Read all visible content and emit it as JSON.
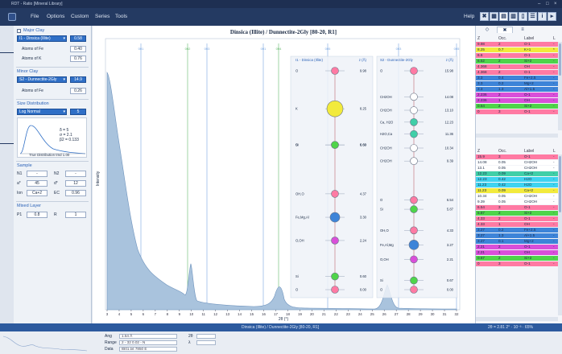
{
  "window": {
    "title": "RDT - Ratio [Mineral Library]"
  },
  "menu": {
    "items": [
      "File",
      "Options",
      "Custom",
      "Series",
      "Tools"
    ],
    "help": "Help"
  },
  "major_clay": {
    "title": "Major Clay",
    "selected": "I1 - Dinsica (Illite)",
    "value": "0.58",
    "fe_label": "Atoms of Fe",
    "fe_value": "0.40",
    "k_label": "Atoms of K",
    "k_value": "0.76"
  },
  "minor_clay": {
    "title": "Minor Clay",
    "selected": "S2 - Dunnectite-2Gly",
    "value": "14.9",
    "fe_label": "Atoms of Fe",
    "fe_value": "0.26"
  },
  "size_distribution": {
    "title": "Size Distribution",
    "selected": "Log Normal",
    "value": "5",
    "stats": [
      "δ = 5",
      "σ = 2.1",
      "β2 = 0.133"
    ],
    "caption": "True Distribution   tmd 1.00"
  },
  "sample": {
    "title": "Sample",
    "n1_label": "N1",
    "n1_value": "-",
    "n2_label": "N2",
    "n2_value": "-",
    "a_label": "a*",
    "a_value": "45",
    "d_label": "d*",
    "d_value": "12",
    "ion_label": "Ion",
    "ion_value": "Ca+2",
    "ec_label": "EC",
    "ec_value": "0.96"
  },
  "mixed_layer": {
    "title": "Mixed Layer",
    "p1_label": "P1",
    "p1_value": "0.8",
    "r_label": "R",
    "r_value": "1"
  },
  "plot": {
    "title": "Dinsica (Illite) / Dunnectite-2Gly  [80-20, R1]",
    "ylabel": "Intensity",
    "xlabel": "2θ (°)",
    "x_ticks": [
      "3",
      "4",
      "5",
      "6",
      "7",
      "8",
      "9",
      "10",
      "11",
      "12",
      "13",
      "14",
      "15",
      "16",
      "17",
      "18",
      "19",
      "20",
      "21",
      "22",
      "23",
      "24",
      "25",
      "26",
      "27",
      "28",
      "29",
      "30",
      "31",
      "32"
    ],
    "peak_labels": [
      "001",
      "002",
      "003",
      "001",
      "004",
      "005",
      "003",
      "005"
    ],
    "illite_structure": {
      "header": [
        "I1 - Dinsica (Illite)",
        "z (Å)"
      ],
      "atoms": [
        {
          "label": "O",
          "z": "9.98",
          "color": "#ff7aa3"
        },
        {
          "label": "K",
          "z": "8.25",
          "color": "#f2ea3c"
        },
        {
          "label": "O",
          "z": "6.60",
          "color": "#ff7aa3"
        },
        {
          "label": "Si",
          "z": "6.60",
          "color": "#4fd44a"
        },
        {
          "label": "OH,O",
          "z": "4.37",
          "color": "#ff7aa3"
        },
        {
          "label": "Fe,Mg,Al",
          "z": "3.30",
          "color": "#3d84d8"
        },
        {
          "label": "O,OH",
          "z": "2.24",
          "color": "#d94fd9"
        },
        {
          "label": "Si",
          "z": "0.60",
          "color": "#4fd44a"
        },
        {
          "label": "O",
          "z": "0.00",
          "color": "#ff7aa3"
        }
      ]
    },
    "smectite_structure": {
      "header": [
        "S2 - Dunnectite-2Gly",
        "z (Å)"
      ],
      "atoms": [
        {
          "label": "O",
          "z": "15.98",
          "color": "#ff7aa3"
        },
        {
          "label": "CH2OH",
          "z": "14.08",
          "color": "#ffffff"
        },
        {
          "label": "CH2OH",
          "z": "13.10",
          "color": "#ffffff"
        },
        {
          "label": "Ca, H2O",
          "z": "12.23",
          "color": "#40cfa8"
        },
        {
          "label": "H2O,Ca",
          "z": "11.36",
          "color": "#40cfa8"
        },
        {
          "label": "CH2OH",
          "z": "10.34",
          "color": "#ffffff"
        },
        {
          "label": "CH2OH",
          "z": "9.39",
          "color": "#ffffff"
        },
        {
          "label": "O",
          "z": "6.54",
          "color": "#ff7aa3"
        },
        {
          "label": "Si",
          "z": "5.87",
          "color": "#4fd44a"
        },
        {
          "label": "OH,O",
          "z": "4.33",
          "color": "#ff7aa3"
        },
        {
          "label": "Fe,Al,Mg",
          "z": "3.27",
          "color": "#3d84d8"
        },
        {
          "label": "O,OH",
          "z": "2.21",
          "color": "#d94fd9"
        },
        {
          "label": "Si",
          "z": "0.67",
          "color": "#4fd44a"
        },
        {
          "label": "O",
          "z": "0.00",
          "color": "#ff7aa3"
        }
      ]
    }
  },
  "right_panel": {
    "tabs": [
      "◇",
      "✖",
      "≡"
    ],
    "columns": [
      "Z",
      "Occ.",
      "Label",
      "L"
    ],
    "table1": [
      {
        "z": "9.98",
        "occ": "2",
        "label": "O-1",
        "l": "-",
        "color": "#ff7aa3"
      },
      {
        "z": "8.25",
        "occ": "0.7",
        "label": "K+1",
        "l": "*",
        "color": "#f2ea3c"
      },
      {
        "z": "6.6",
        "occ": "3",
        "label": "O-1",
        "l": "-",
        "color": "#ff7aa3"
      },
      {
        "z": "6.52",
        "occ": "2",
        "label": "Si+2",
        "l": "-",
        "color": "#4fd44a"
      },
      {
        "z": "4.368",
        "occ": "1",
        "label": "OH",
        "l": "-",
        "color": "#ff7aa3"
      },
      {
        "z": "4.368",
        "occ": "2",
        "label": "O-1",
        "l": "-",
        "color": "#ff7aa3"
      },
      {
        "z": "3.3",
        "occ": "0.4",
        "label": "Fe+2.5",
        "l": "-",
        "color": "#3d84d8"
      },
      {
        "z": "3.3",
        "occ": "0.2",
        "label": "Mg+2",
        "l": "-",
        "color": "#3d84d8"
      },
      {
        "z": "3.3",
        "occ": "1.3",
        "label": "Al+1.5",
        "l": "-",
        "color": "#3d84d8"
      },
      {
        "z": "2.236",
        "occ": "2",
        "label": "O-1",
        "l": "-",
        "color": "#d94fd9"
      },
      {
        "z": "2.236",
        "occ": "1",
        "label": "OH",
        "l": "-",
        "color": "#d94fd9"
      },
      {
        "z": "0.54",
        "occ": "2",
        "label": "Si+2",
        "l": "-",
        "color": "#4fd44a"
      },
      {
        "z": "0",
        "occ": "3",
        "label": "O-1",
        "l": "-",
        "color": "#ff7aa3"
      }
    ],
    "table2": [
      {
        "z": "15.9",
        "occ": "3",
        "label": "O-1",
        "l": "-",
        "color": "#ff7aa3"
      },
      {
        "z": "14.08",
        "occ": "0.05",
        "label": "CH2OH",
        "l": "-",
        "color": "#ffffff"
      },
      {
        "z": "13.1",
        "occ": "0.05",
        "label": "CH2OH",
        "l": "-",
        "color": "#ffffff"
      },
      {
        "z": "12.23",
        "occ": "0.09",
        "label": "Ca+2",
        "l": "-",
        "color": "#40cfa8"
      },
      {
        "z": "12.23",
        "occ": "0.42",
        "label": "H2O",
        "l": "-",
        "color": "#3fd3f0"
      },
      {
        "z": "11.23",
        "occ": "0.42",
        "label": "H2O",
        "l": "-",
        "color": "#3fd3f0"
      },
      {
        "z": "11.23",
        "occ": "0.09",
        "label": "Ca+2",
        "l": "-",
        "color": "#f2ea3c"
      },
      {
        "z": "10.34",
        "occ": "0.05",
        "label": "CH2OH",
        "l": "-",
        "color": "#ffffff"
      },
      {
        "z": "9.39",
        "occ": "0.05",
        "label": "CH2OH",
        "l": "-",
        "color": "#ffffff"
      },
      {
        "z": "6.54",
        "occ": "3",
        "label": "O-1",
        "l": "-",
        "color": "#ff7aa3"
      },
      {
        "z": "5.87",
        "occ": "2",
        "label": "Si+2",
        "l": "-",
        "color": "#4fd44a"
      },
      {
        "z": "4.33",
        "occ": "2",
        "label": "O-1",
        "l": "-",
        "color": "#ff7aa3"
      },
      {
        "z": "4.33",
        "occ": "1",
        "label": "OH",
        "l": "-",
        "color": "#ff7aa3"
      },
      {
        "z": "3.27",
        "occ": "0.2",
        "label": "Fe+2.5",
        "l": "-",
        "color": "#3d84d8"
      },
      {
        "z": "3.27",
        "occ": "1.3",
        "label": "Al+1.5",
        "l": "-",
        "color": "#3d84d8"
      },
      {
        "z": "3.27",
        "occ": "0.1",
        "label": "Mg+2",
        "l": "-",
        "color": "#3d84d8"
      },
      {
        "z": "2.21",
        "occ": "2",
        "label": "O-1",
        "l": "-",
        "color": "#d94fd9"
      },
      {
        "z": "2.21",
        "occ": "1",
        "label": "OH",
        "l": "-",
        "color": "#d94fd9"
      },
      {
        "z": "0.67",
        "occ": "2",
        "label": "Si+2",
        "l": "-",
        "color": "#4fd44a"
      },
      {
        "z": "0",
        "occ": "3",
        "label": "O-1",
        "l": "-",
        "color": "#ff7aa3"
      }
    ]
  },
  "status": {
    "text": "Dinsica (Illite) / Dunnectite-2Gly  [80-20, R1]",
    "coords": "2θ = 2.81   2° · 10⁻³ · 65%"
  },
  "bottom": {
    "labels": [
      "Ang",
      "Range",
      "Data"
    ],
    "values": [
      "1.54 Å",
      "2 - 32   0.02 - N",
      "IB01.txt  7850 E"
    ],
    "col2_labels": [
      "2θ",
      "λ"
    ],
    "col2_values": [
      "",
      ""
    ]
  },
  "colors": {
    "accent": "#2f6fc6",
    "menubar": "#243a62",
    "status": "#2c5a9e",
    "curve_fill": "#a9c3dd"
  }
}
